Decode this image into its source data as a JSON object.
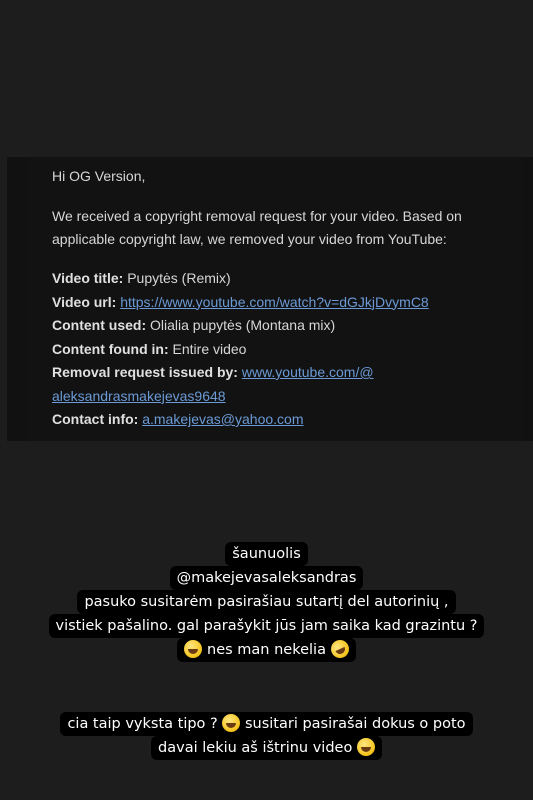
{
  "email": {
    "greeting": "Hi OG Version,",
    "intro": "We received a copyright removal request for your video. Based on applicable copyright law, we removed your video from YouTube:",
    "video_title_label": "Video title:",
    "video_title_value": "Pupytės (Remix)",
    "video_url_label": "Video url:",
    "video_url_value": "https://www.youtube.com/watch?v=dGJkjDvymC8",
    "content_used_label": "Content used:",
    "content_used_value": "Olialia pupytės (Montana mix)",
    "content_found_label": "Content found in:",
    "content_found_value": "Entire video",
    "removal_label": "Removal request issued by:",
    "removal_value_line1": "www.youtube.com/@",
    "removal_value_line2": "aleksandrasmakejevas9648",
    "contact_label": "Contact info:",
    "contact_value": "a.makejevas@yahoo.com"
  },
  "caption1": {
    "lines": [
      "šaunuolis",
      "@makejevasaleksandras",
      "pasuko susitarėm pasirašiau sutartį del autorinių ,",
      "vistiek pašalino. gal parašykit jūs jam saika kad grazintu ?",
      "nes man nekelia"
    ],
    "emoji_smile": "grinning-face-emoji",
    "emoji_rofl": "rolling-on-floor-laughing-emoji"
  },
  "caption2": {
    "line1_before": "cia taip vyksta tipo ?",
    "line1_after": "susitari pasirašai dokus o poto",
    "line2": "davai lekiu aš ištrinu video",
    "emoji": "grinning-face-emoji"
  }
}
